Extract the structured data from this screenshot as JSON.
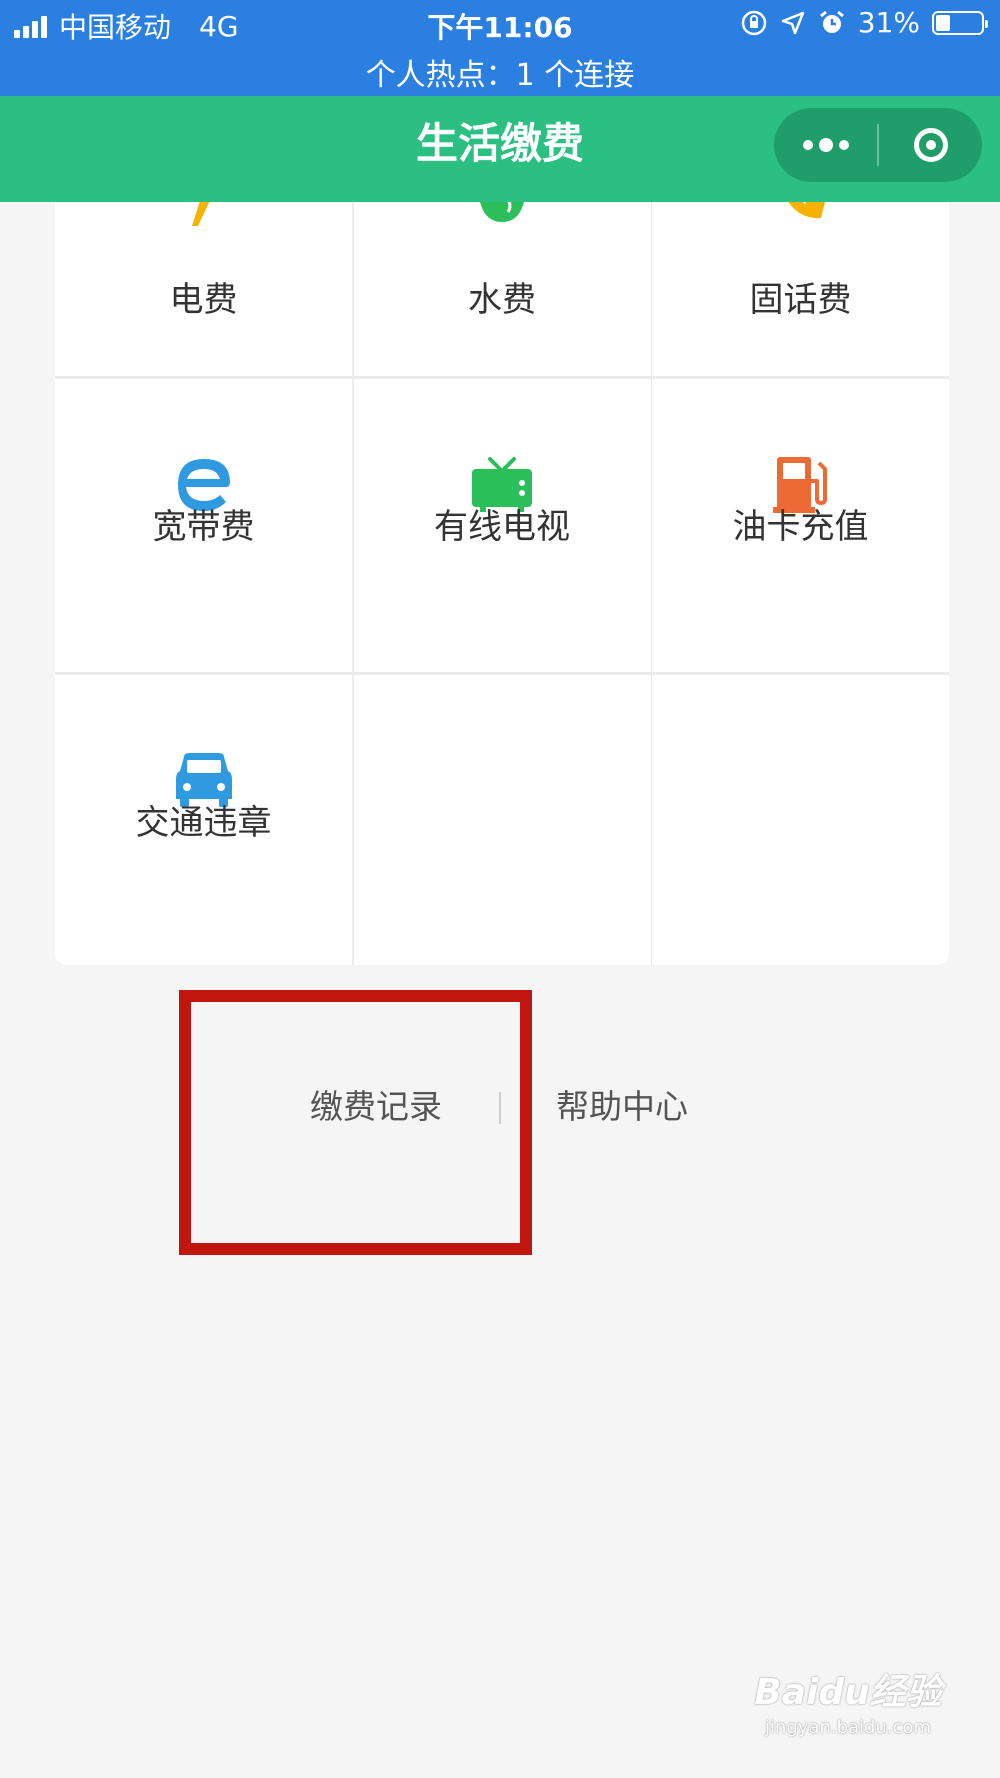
{
  "status_bar": {
    "carrier": "中国移动",
    "network": "4G",
    "time": "下午11:06",
    "battery": "31%",
    "battery_level": 0.31,
    "hotspot": "个人热点：1 个连接"
  },
  "title_bar": {
    "title": "生活缴费",
    "capsule": {
      "more_icon": "more-dots-icon",
      "close_icon": "mini-program-target-icon"
    }
  },
  "services": [
    {
      "label": "电费",
      "icon": "lightning-icon"
    },
    {
      "label": "水费",
      "icon": "water-drop-icon"
    },
    {
      "label": "固话费",
      "icon": "telephone-icon"
    },
    {
      "label": "宽带费",
      "icon": "browser-e-icon"
    },
    {
      "label": "有线电视",
      "icon": "tv-icon"
    },
    {
      "label": "油卡充值",
      "icon": "fuel-pump-icon"
    },
    {
      "label": "交通违章",
      "icon": "car-icon"
    }
  ],
  "footer_links": {
    "records": "缴费记录",
    "help": "帮助中心"
  },
  "colors": {
    "status_bar": "#2b7fe0",
    "title_bar": "#2bbf82",
    "highlight": "#c0160e",
    "broadband": "#2f9ae0",
    "tv": "#2bbf5a",
    "fuel": "#ee6a35",
    "car": "#2f9ae0"
  },
  "watermark": {
    "brand": "Baidu经验",
    "url": "jingyan.baidu.com"
  }
}
